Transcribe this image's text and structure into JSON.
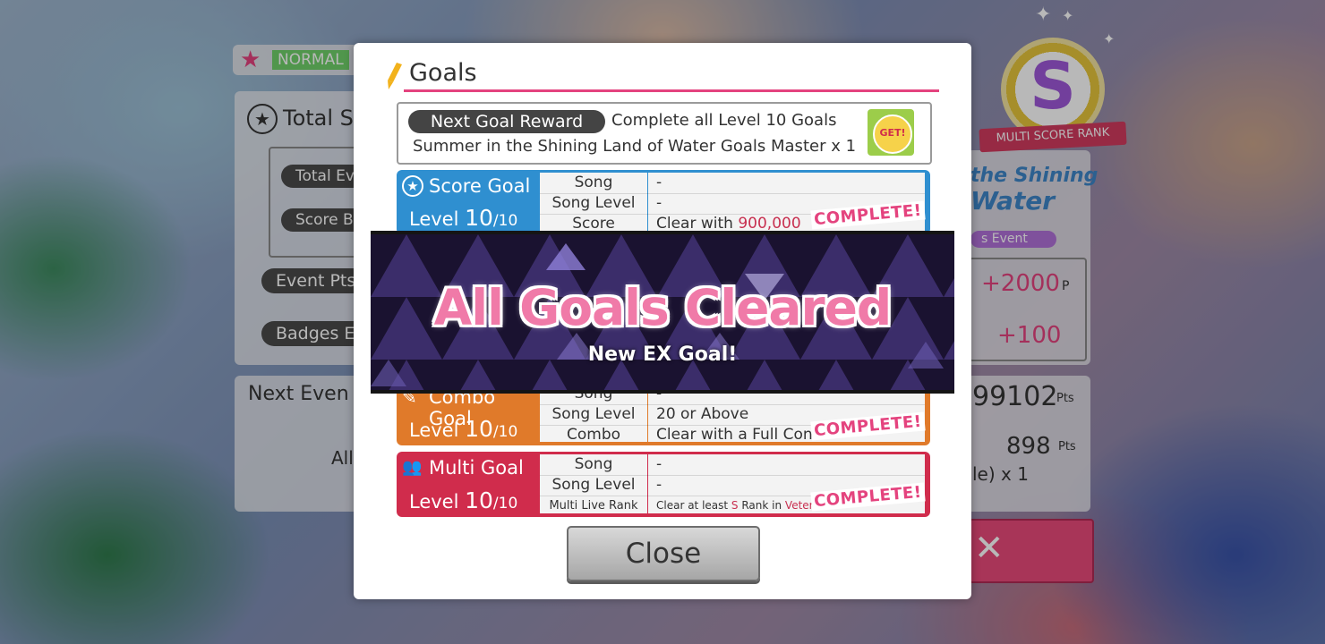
{
  "background": {
    "difficulty_label": "NORMAL",
    "total_label": "Total S",
    "total_event_label": "Total Eve",
    "score_label": "Score B",
    "event_pts_label": "Event Pts",
    "badges_label": "Badges E",
    "next_event_label": "Next Even",
    "all_label": "All",
    "rank_letter": "S",
    "rank_caption": "MULTI SCORE RANK",
    "event_logo_line1": "the Shining",
    "event_logo_line2": "Water",
    "event_tag": "s Event",
    "points_plus": "+2000",
    "points_unit": "P",
    "badges_plus": "+100",
    "total_pts": "99102",
    "total_pts_unit": "Pts",
    "next_pts": "898",
    "next_pts_unit": "Pts",
    "reward_tail": "le) x 1"
  },
  "modal": {
    "title": "Goals",
    "next_goal_reward_label": "Next Goal Reward",
    "reward_condition": "Complete all Level 10 Goals",
    "reward_item": "Summer in the Shining Land of Water Goals Master x 1",
    "reward_badge_text": "GET!",
    "close_label": "Close",
    "complete_label": "COMPLETE!"
  },
  "goals": {
    "score": {
      "name": "Score Goal",
      "level_prefix": "Level ",
      "level": "10",
      "level_max": "/10",
      "rows": {
        "song_key": "Song",
        "song_val": "-",
        "level_key": "Song Level",
        "level_val": "-",
        "cond_key": "Score",
        "cond_prefix": "Clear with ",
        "cond_hl": "900,000"
      }
    },
    "combo": {
      "name": "Combo Goal",
      "level_prefix": "Level ",
      "level": "10",
      "level_max": "/10",
      "rows": {
        "song_key": "Song",
        "song_val": "-",
        "level_key": "Song Level",
        "level_val": "20 or Above",
        "cond_key": "Combo",
        "cond_val": "Clear with a Full Con"
      }
    },
    "multi": {
      "name": "Multi Goal",
      "level_prefix": "Level ",
      "level": "10",
      "level_max": "/10",
      "rows": {
        "song_key": "Song",
        "song_val": "-",
        "level_key": "Song Level",
        "level_val": "-",
        "cond_key": "Multi Live Rank",
        "cond_prefix": "Clear at least ",
        "cond_hl1": "S",
        "cond_mid": " Rank in ",
        "cond_hl2": "Vetera"
      }
    }
  },
  "banner": {
    "title": "All Goals Cleared",
    "subtitle": "New EX Goal!"
  },
  "colors": {
    "accent_pink": "#e4437e",
    "score_blue": "#2f8fd0",
    "combo_orange": "#e07a2a",
    "multi_red": "#d02c4c",
    "banner_purple": "#2a1f48"
  }
}
